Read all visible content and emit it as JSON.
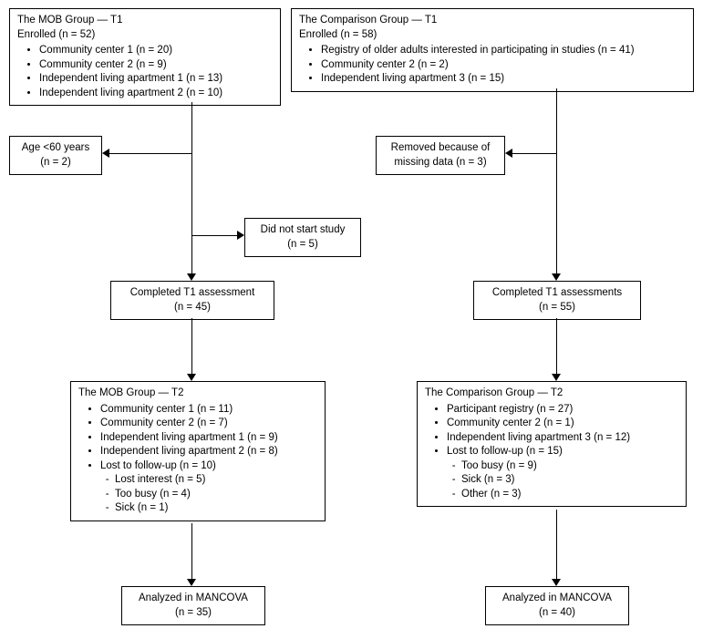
{
  "mob": {
    "t1": {
      "title": "The MOB Group — T1\nEnrolled (n = 52)",
      "items": [
        "Community center 1 (n = 20)",
        "Community center 2 (n = 9)",
        "Independent living apartment 1 (n = 13)",
        "Independent living apartment 2 (n = 10)"
      ]
    },
    "age_exclusion": "Age <60 years\n(n = 2)",
    "didnotstart": "Did not start study\n(n = 5)",
    "completed_t1": "Completed T1 assessment\n(n = 45)",
    "t2": {
      "title": "The MOB Group — T2",
      "items": [
        "Community center  1 (n = 11)",
        "Community center 2 (n = 7)",
        "Independent living apartment 1 (n = 9)",
        "Independent living apartment 2 (n = 8)"
      ],
      "lost": "Lost to follow-up (n = 10)",
      "lost_sub": [
        "Lost interest (n = 5)",
        "Too busy (n = 4)",
        "Sick (n = 1)"
      ]
    },
    "analyzed": "Analyzed in MANCOVA\n(n = 35)"
  },
  "comp": {
    "t1": {
      "title": "The Comparison Group — T1\nEnrolled (n = 58)",
      "items": [
        "Registry of older adults interested in participating in studies (n = 41)",
        "Community center 2 (n = 2)",
        "Independent living apartment 3 (n = 15)"
      ]
    },
    "removed": "Removed because of\nmissing data (n = 3)",
    "completed_t1": "Completed T1 assessments\n(n = 55)",
    "t2": {
      "title": "The Comparison Group — T2",
      "items": [
        "Participant registry (n = 27)",
        "Community center 2 (n = 1)",
        "Independent living apartment 3 (n = 12)"
      ],
      "lost": "Lost to follow-up (n = 15)",
      "lost_sub": [
        "Too busy (n = 9)",
        "Sick (n = 3)",
        "Other (n = 3)"
      ]
    },
    "analyzed": "Analyzed in MANCOVA\n(n = 40)"
  }
}
